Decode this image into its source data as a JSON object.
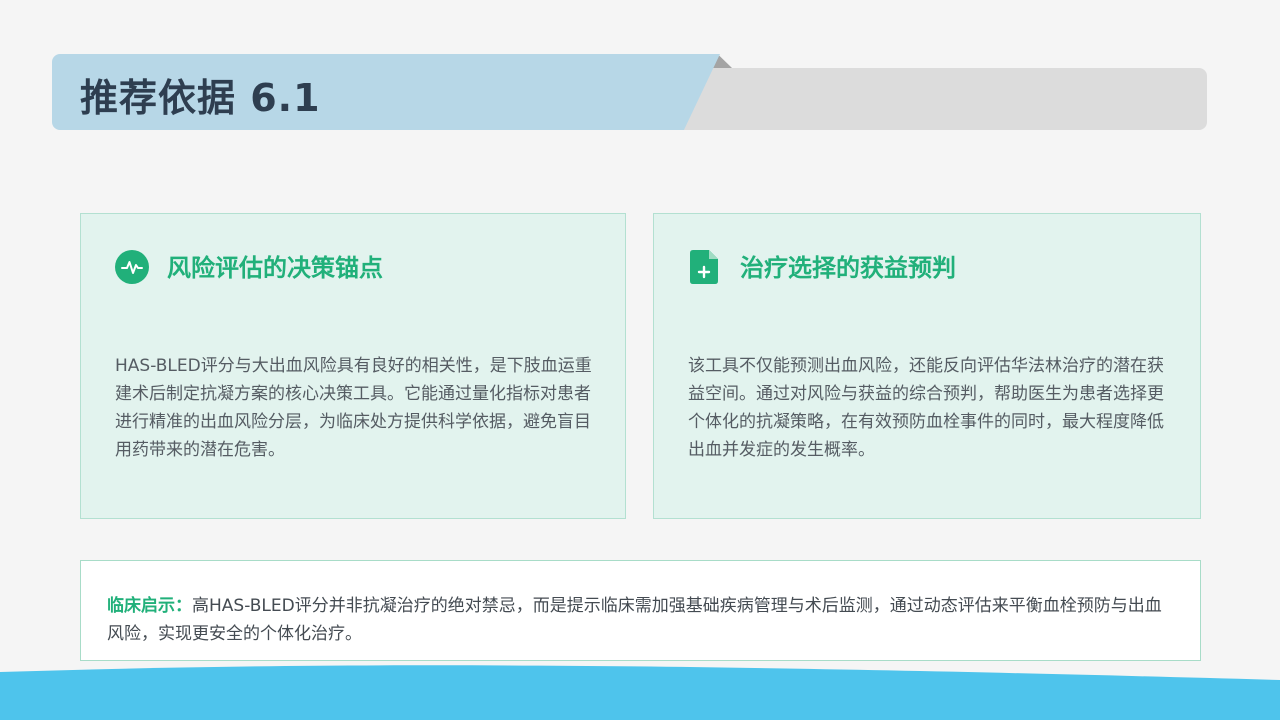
{
  "title": "推荐依据 6.1",
  "colors": {
    "accent_green": "#21b07a",
    "title_band": "#b7d7e7",
    "card_bg": "#e2f3ee",
    "wave_blue": "#4ec4ec"
  },
  "cards": [
    {
      "icon": "pulse-circle-icon",
      "title": "风险评估的决策锚点",
      "text": "HAS-BLED评分与大出血风险具有良好的相关性，是下肢血运重建术后制定抗凝方案的核心决策工具。它能通过量化指标对患者进行精准的出血风险分层，为临床处方提供科学依据，避免盲目用药带来的潜在危害。"
    },
    {
      "icon": "file-plus-icon",
      "title": "治疗选择的获益预判",
      "text": "该工具不仅能预测出血风险，还能反向评估华法林治疗的潜在获益空间。通过对风险与获益的综合预判，帮助医生为患者选择更个体化的抗凝策略，在有效预防血栓事件的同时，最大程度降低出血并发症的发生概率。"
    }
  ],
  "note": {
    "label": "临床启示：",
    "text": "高HAS-BLED评分并非抗凝治疗的绝对禁忌，而是提示临床需加强基础疾病管理与术后监测，通过动态评估来平衡血栓预防与出血风险，实现更安全的个体化治疗。"
  }
}
